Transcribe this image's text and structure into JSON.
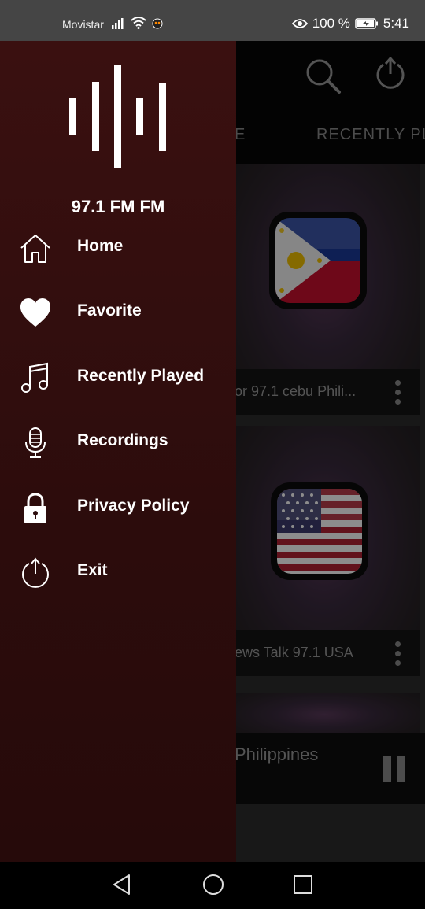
{
  "status_bar": {
    "carrier": "Movistar",
    "battery": "100 %",
    "time": "5:41"
  },
  "drawer": {
    "app_name": "97.1 FM FM",
    "items": [
      {
        "label": "Home",
        "icon": "home-icon"
      },
      {
        "label": "Favorite",
        "icon": "heart-icon"
      },
      {
        "label": "Recently Played",
        "icon": "music-note-icon"
      },
      {
        "label": "Recordings",
        "icon": "microphone-icon"
      },
      {
        "label": "Privacy Policy",
        "icon": "lock-icon"
      },
      {
        "label": "Exit",
        "icon": "power-icon"
      }
    ]
  },
  "background": {
    "tabs": [
      "E",
      "RECENTLY PL"
    ],
    "cards": [
      {
        "title": "or 97.1 cebu Phili...",
        "flag": "philippines"
      },
      {
        "title": "ews Talk 97.1 USA",
        "flag": "usa"
      }
    ],
    "player_title": "Philippines"
  },
  "colors": {
    "drawer_top": "#3a1010",
    "drawer_bottom": "#260a0a",
    "status_bar": "#454545"
  }
}
